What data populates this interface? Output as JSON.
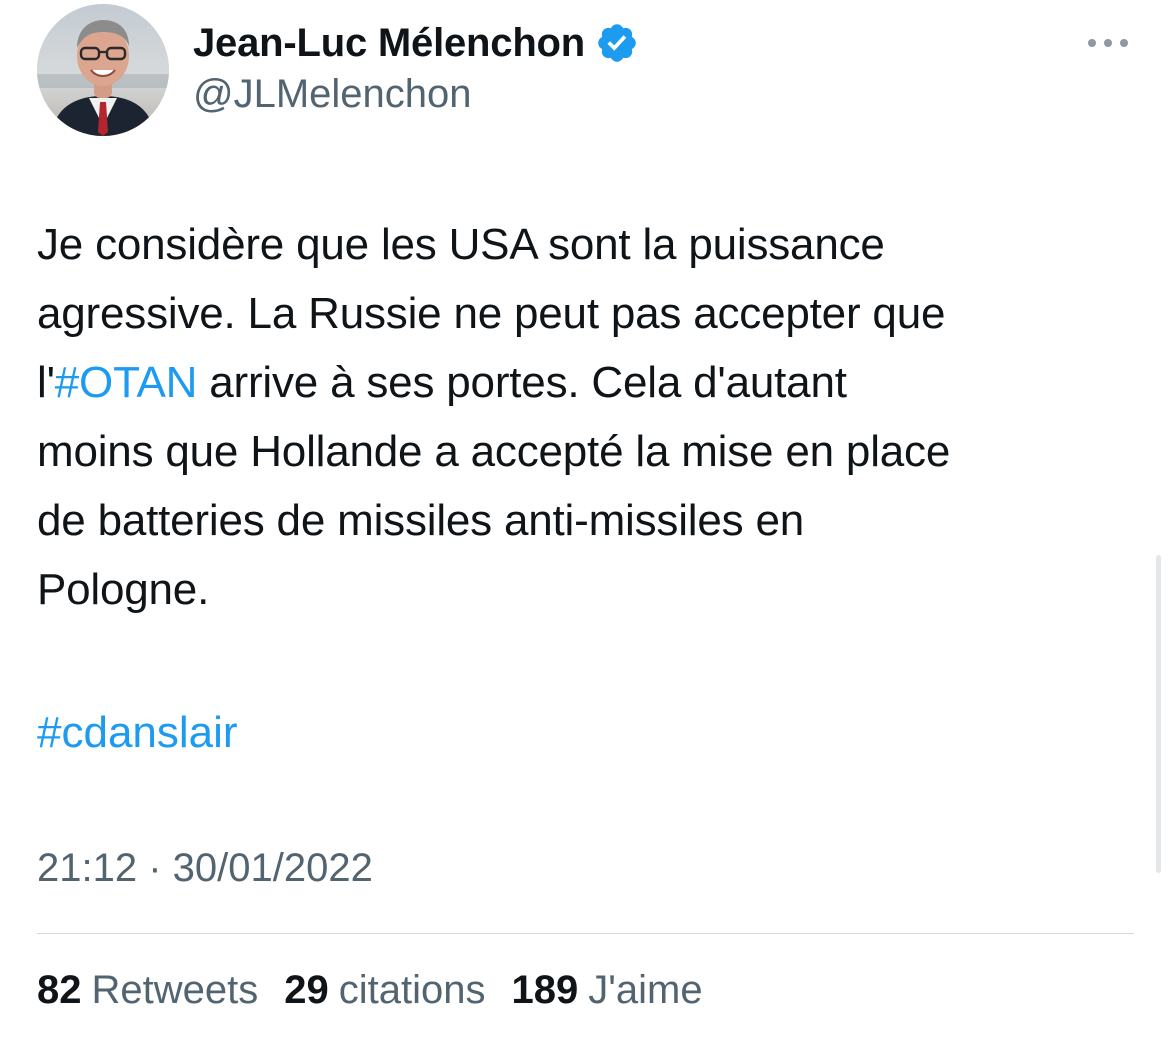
{
  "author": {
    "display_name": "Jean-Luc Mélenchon",
    "handle": "@JLMelenchon",
    "verified_icon": "verified-badge-icon",
    "avatar_icon": "avatar"
  },
  "menu": {
    "more_icon": "more-options-icon"
  },
  "tweet": {
    "lines": [
      [
        {
          "text": "Je considère que les USA sont la puissance",
          "type": "text"
        }
      ],
      [
        {
          "text": "agressive. La Russie ne peut pas accepter que",
          "type": "text"
        }
      ],
      [
        {
          "text": "l'",
          "type": "text"
        },
        {
          "text": "#OTAN",
          "type": "hashtag"
        },
        {
          "text": " arrive à ses portes. Cela d'autant",
          "type": "text"
        }
      ],
      [
        {
          "text": "moins que Hollande a accepté la mise en place",
          "type": "text"
        }
      ],
      [
        {
          "text": "de batteries de missiles anti-missiles en",
          "type": "text"
        }
      ],
      [
        {
          "text": "Pologne.",
          "type": "text"
        }
      ]
    ],
    "hashtag_footer": "#cdanslair",
    "timestamp": "21:12 · 30/01/2022"
  },
  "stats": {
    "retweets": {
      "count": "82",
      "label": "Retweets"
    },
    "quotes": {
      "count": "29",
      "label": "citations"
    },
    "likes": {
      "count": "189",
      "label": "J'aime"
    }
  },
  "colors": {
    "text": "#0f1419",
    "secondary": "#536471",
    "link": "#1d9bf0",
    "verified": "#1d9bf0",
    "divider": "#cfd9de"
  }
}
